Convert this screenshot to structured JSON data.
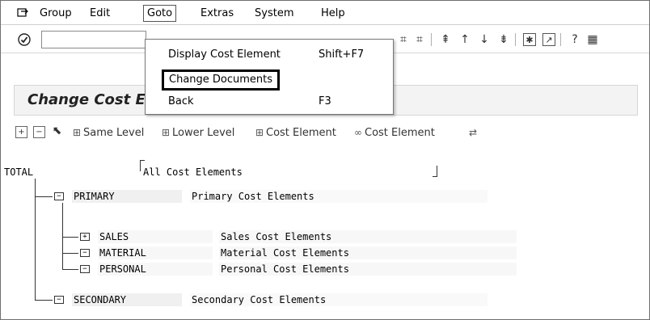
{
  "menu": {
    "items": [
      "Group",
      "Edit",
      "Goto",
      "Extras",
      "System",
      "Help"
    ],
    "active": "Goto"
  },
  "goto_menu": {
    "items": [
      {
        "label": "Display Cost Element",
        "shortcut": "Shift+F7"
      },
      {
        "label": "Change Documents",
        "shortcut": ""
      },
      {
        "label": "Back",
        "shortcut": "F3"
      }
    ]
  },
  "toolbar": {
    "command_field_value": ""
  },
  "page": {
    "title": "Change Cost Element Group"
  },
  "app_toolbar": {
    "same_level": "Same Level",
    "lower_level": "Lower Level",
    "cost_element": "Cost Element",
    "cost_element_2": "Cost Element"
  },
  "tree": {
    "root": {
      "id": "TOTAL",
      "desc": "All Cost Elements"
    },
    "primary": {
      "id": "PRIMARY",
      "desc": "Primary Cost Elements"
    },
    "children": [
      {
        "id": "SALES",
        "desc": "Sales Cost Elements",
        "icon": "⊞"
      },
      {
        "id": "MATERIAL",
        "desc": "Material Cost Elements",
        "icon": "⊟"
      },
      {
        "id": "PERSONAL",
        "desc": "Personal Cost Elements",
        "icon": "⊟"
      }
    ],
    "secondary": {
      "id": "SECONDARY",
      "desc": "Secondary Cost Elements"
    }
  }
}
